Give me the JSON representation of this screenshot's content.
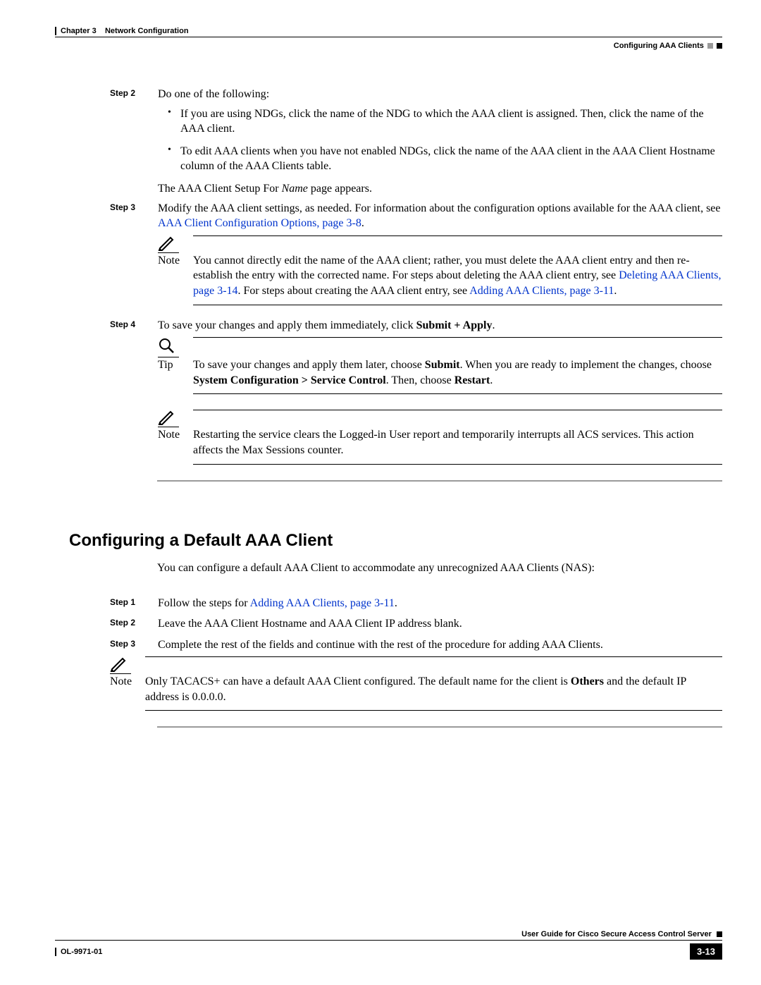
{
  "header": {
    "chapter": "Chapter 3",
    "chapter_title": "Network Configuration",
    "section_right": "Configuring AAA Clients"
  },
  "steps": {
    "s2": {
      "label": "Step 2",
      "intro": "Do one of the following:",
      "b1": "If you are using NDGs, click the name of the NDG to which the AAA client is assigned. Then, click the name of the AAA client.",
      "b2": "To edit AAA clients when you have not enabled NDGs, click the name of the AAA client in the AAA Client Hostname column of the AAA Clients table.",
      "result_a": "The AAA Client Setup For ",
      "result_name": "Name",
      "result_b": " page appears."
    },
    "s3": {
      "label": "Step 3",
      "p_a": "Modify the AAA client settings, as needed. For information about the configuration options available for the AAA client, see ",
      "link1": "AAA Client Configuration Options, page 3-8",
      "p_b": "."
    },
    "note1": {
      "label": "Note",
      "t1": "You cannot directly edit the name of the AAA client; rather, you must delete the AAA client entry and then re-establish the entry with the corrected name. For steps about deleting the AAA client entry, see ",
      "link_del": "Deleting AAA Clients, page 3-14",
      "t2": ". For steps about creating the AAA client entry, see ",
      "link_add": "Adding AAA Clients, page 3-11",
      "t3": "."
    },
    "s4": {
      "label": "Step 4",
      "p_a": "To save your changes and apply them immediately, click ",
      "bold": "Submit + Apply",
      "p_b": "."
    },
    "tip": {
      "label": "Tip",
      "t1": "To save your changes and apply them later, choose ",
      "b1": "Submit",
      "t2": ". When you are ready to implement the changes, choose ",
      "b2": "System Configuration > Service Control",
      "t3": ". Then, choose ",
      "b3": "Restart",
      "t4": "."
    },
    "note2": {
      "label": "Note",
      "text": "Restarting the service clears the Logged-in User report and temporarily interrupts all ACS services. This action affects the Max Sessions counter."
    }
  },
  "section2": {
    "heading": "Configuring a Default AAA Client",
    "intro": "You can configure a default AAA Client to accommodate any unrecognized AAA Clients (NAS):",
    "s1": {
      "label": "Step 1",
      "t1": "Follow the steps for ",
      "link": "Adding AAA Clients, page 3-11",
      "t2": "."
    },
    "s2": {
      "label": "Step 2",
      "text": "Leave the AAA Client Hostname and AAA Client IP address blank."
    },
    "s3": {
      "label": "Step 3",
      "text": "Complete the rest of the fields and continue with the rest of the procedure for adding AAA Clients."
    },
    "note": {
      "label": "Note",
      "t1": "Only TACACS+ can have a default AAA Client configured. The default name for the client is ",
      "b1": "Others",
      "t2": " and the default IP address is 0.0.0.0."
    }
  },
  "footer": {
    "guide": "User Guide for Cisco Secure Access Control Server",
    "doc": "OL-9971-01",
    "page": "3-13"
  }
}
